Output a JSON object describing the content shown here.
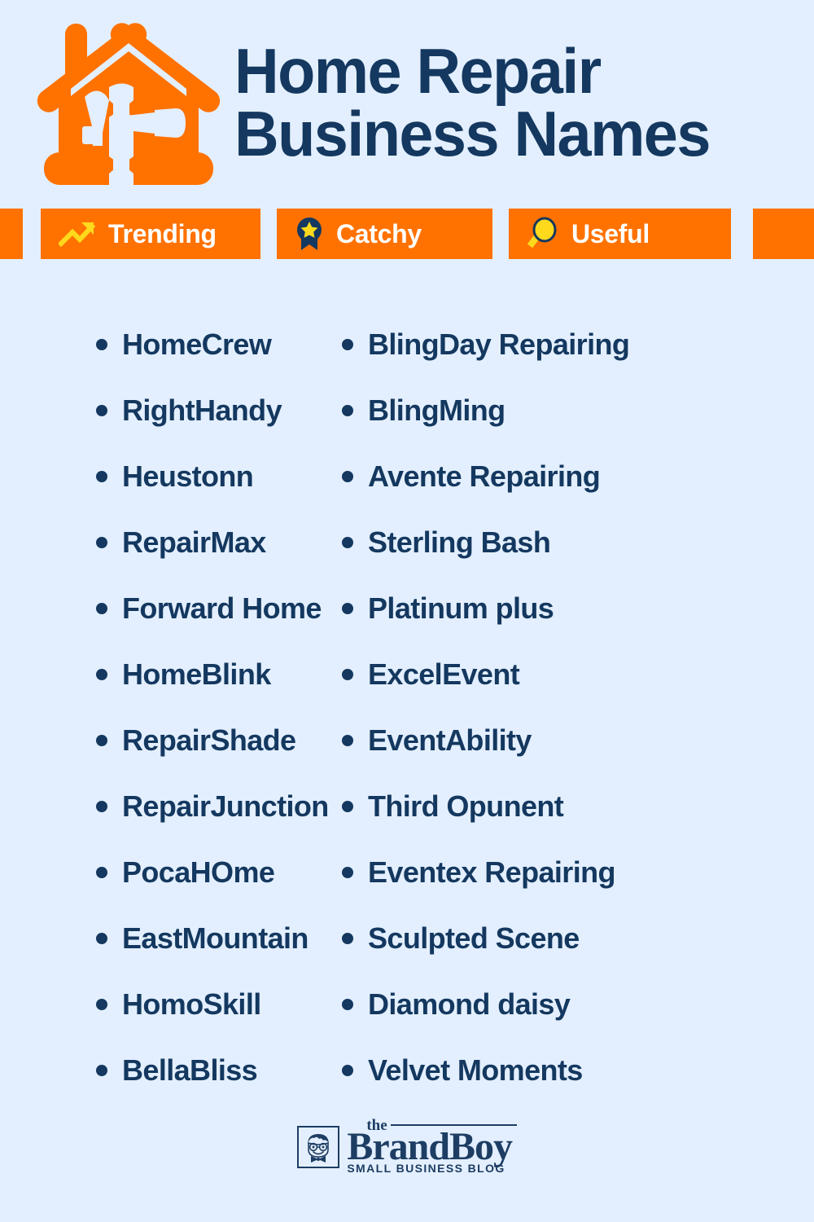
{
  "theme": {
    "background": "#e3efff",
    "navy": "#14385f",
    "orange": "#ff7200",
    "yellow": "#ffd91c",
    "white": "#ffffff",
    "logo_navy": "#1d3d63"
  },
  "header": {
    "logo_icon": "house-with-tools-icon",
    "title_line_1": "Home Repair",
    "title_line_2": "Business Names"
  },
  "badges": [
    {
      "label": "Trending",
      "icon": "trending-up-icon"
    },
    {
      "label": "Catchy",
      "icon": "award-medal-star-icon"
    },
    {
      "label": "Useful",
      "icon": "magnifying-glass-icon"
    }
  ],
  "lists": {
    "left_column": [
      "HomeCrew",
      "RightHandy",
      "Heustonn",
      "RepairMax",
      "Forward Home",
      "HomeBlink",
      "RepairShade",
      "RepairJunction",
      "PocaHOme",
      "EastMountain",
      "HomoSkill",
      "BellaBliss"
    ],
    "right_column": [
      "BlingDay Repairing",
      "BlingMing",
      "Avente Repairing",
      "Sterling Bash",
      "Platinum plus",
      "ExcelEvent",
      "EventAbility",
      "Third Opunent",
      "Eventex Repairing",
      "Sculpted Scene",
      "Diamond daisy",
      "Velvet Moments"
    ]
  },
  "footer": {
    "logo_icon": "boy-face-with-glasses-icon",
    "brand_prefix": "the",
    "brand_name": "BrandBoy",
    "brand_tagline": "SMALL BUSINESS BLOG"
  }
}
